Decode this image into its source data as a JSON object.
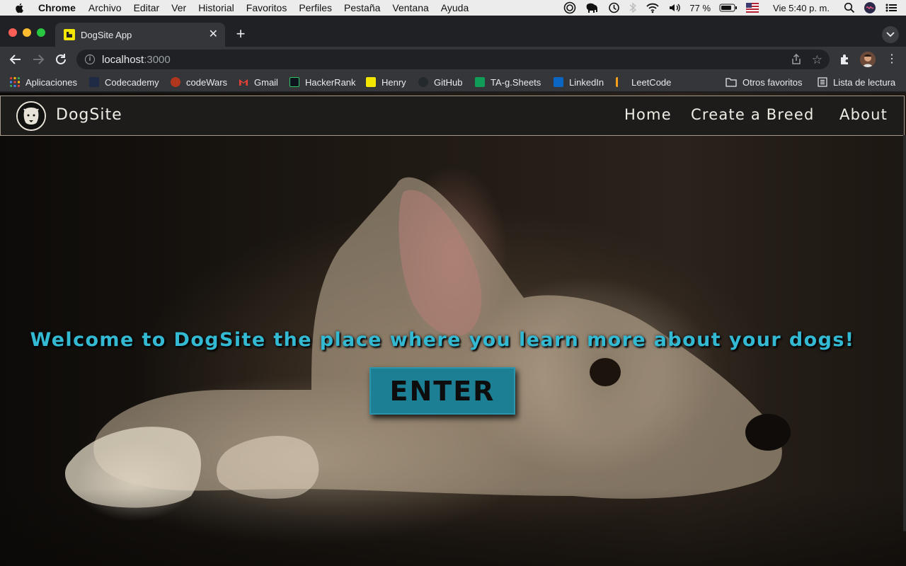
{
  "menubar": {
    "app": "Chrome",
    "items": [
      "Archivo",
      "Editar",
      "Ver",
      "Historial",
      "Favoritos",
      "Perfiles",
      "Pestaña",
      "Ventana",
      "Ayuda"
    ],
    "battery": "77 %",
    "clock": "Vie 5:40 p. m."
  },
  "browser": {
    "tab_title": "DogSite App",
    "url_host": "localhost",
    "url_port": ":3000"
  },
  "bookmarks": {
    "items": [
      {
        "label": "Aplicaciones",
        "icon": "apps-grid-icon",
        "color": "#e94235"
      },
      {
        "label": "Codecademy",
        "icon": "codecademy-icon",
        "color": "#1f2a44"
      },
      {
        "label": "codeWars",
        "icon": "codewars-icon",
        "color": "#b1361e"
      },
      {
        "label": "Gmail",
        "icon": "gmail-icon",
        "color": "#ea4335"
      },
      {
        "label": "HackerRank",
        "icon": "hackerrank-icon",
        "color": "#0e141e"
      },
      {
        "label": "Henry",
        "icon": "henry-icon",
        "color": "#f3e600"
      },
      {
        "label": "GitHub",
        "icon": "github-icon",
        "color": "#24292e"
      },
      {
        "label": "TA-g.Sheets",
        "icon": "sheets-icon",
        "color": "#0f9d58"
      },
      {
        "label": "LinkedIn",
        "icon": "linkedin-icon",
        "color": "#0a66c2"
      },
      {
        "label": "LeetCode",
        "icon": "leetcode-icon",
        "color": "#f89f1b"
      }
    ],
    "other": "Otros favoritos",
    "reading": "Lista de lectura"
  },
  "site": {
    "brand": "DogSite",
    "nav": [
      "Home",
      "Create a Breed",
      "About"
    ],
    "welcome": "Welcome to DogSite the place where you learn more about your dogs!",
    "enter_label": "ENTER",
    "accent": "#34b9d3",
    "button_color": "#1d7f94"
  }
}
